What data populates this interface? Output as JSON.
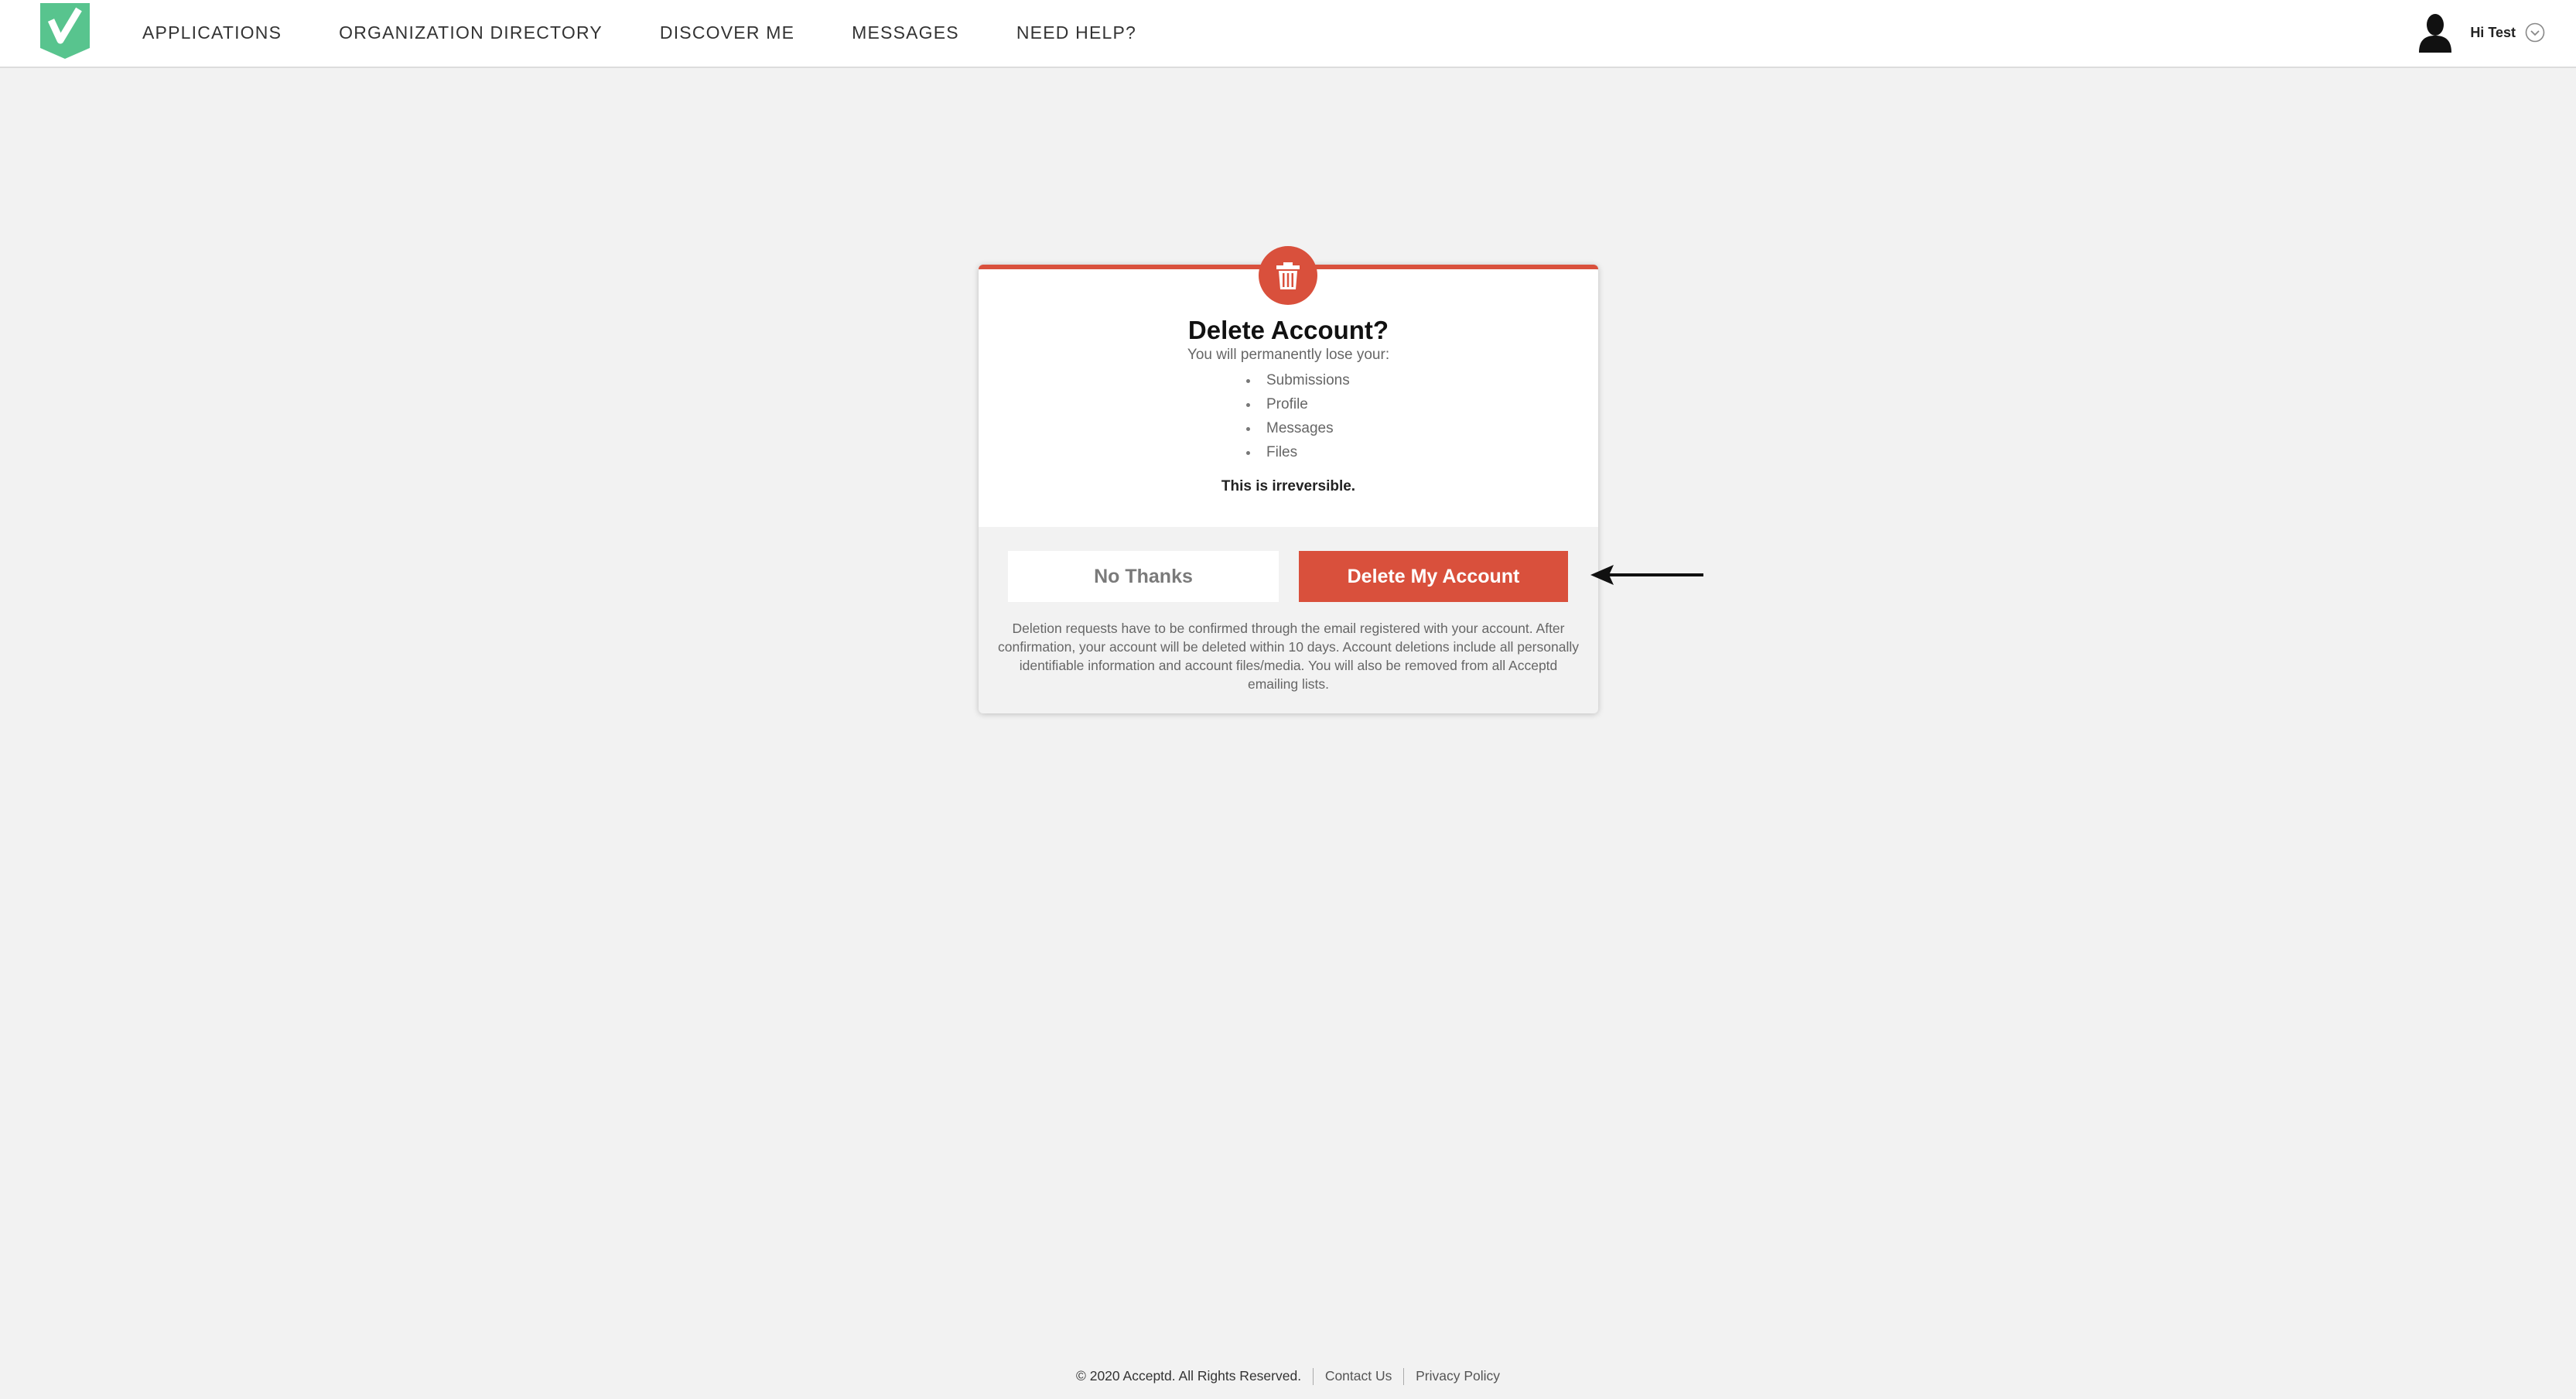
{
  "colors": {
    "accent": "#d9503c",
    "brand": "#58c48e",
    "background": "#f2f2f2"
  },
  "nav": {
    "logo_icon": "acceptd-checkmark-logo",
    "links": [
      {
        "label": "APPLICATIONS"
      },
      {
        "label": "ORGANIZATION DIRECTORY"
      },
      {
        "label": "DISCOVER ME"
      },
      {
        "label": "MESSAGES"
      },
      {
        "label": "NEED HELP?"
      }
    ],
    "user": {
      "avatar_icon": "user-silhouette-icon",
      "greeting": "Hi Test",
      "menu_icon": "chevron-down-circle-icon"
    }
  },
  "modal": {
    "badge_icon": "trash-icon",
    "title": "Delete Account?",
    "subtitle": "You will permanently lose your:",
    "items": [
      "Submissions",
      "Profile",
      "Messages",
      "Files"
    ],
    "warning": "This is irreversible.",
    "cancel_label": "No Thanks",
    "delete_label": "Delete My Account",
    "disclaimer": "Deletion requests have to be confirmed through the email registered with your account. After confirmation, your account will be deleted within 10 days. Account deletions include all personally identifiable information and account files/media. You will also be removed from all Acceptd emailing lists."
  },
  "annotation": {
    "icon": "left-arrow-icon"
  },
  "footer": {
    "copyright": "© 2020 Acceptd. All Rights Reserved.",
    "contact_label": "Contact Us",
    "privacy_label": "Privacy Policy"
  }
}
